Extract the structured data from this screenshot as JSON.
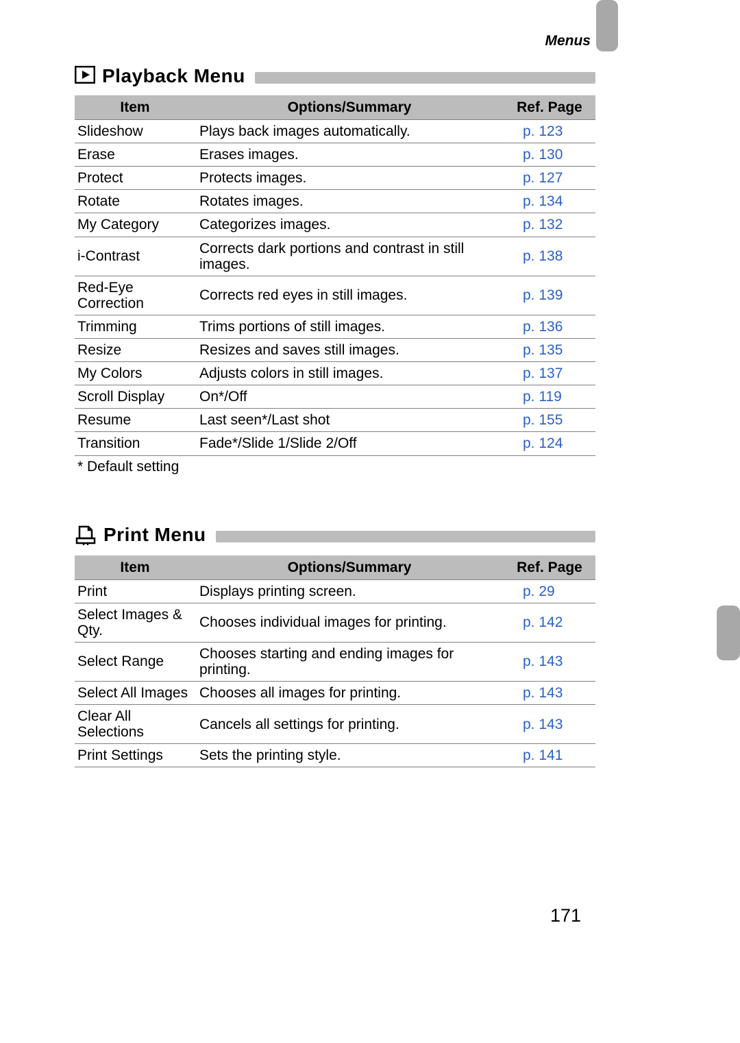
{
  "header": {
    "section_label": "Menus"
  },
  "playback_menu": {
    "title": "Playback Menu",
    "icon": "playback-icon",
    "columns": {
      "item": "Item",
      "options": "Options/Summary",
      "ref": "Ref. Page"
    },
    "rows": [
      {
        "item": "Slideshow",
        "options": "Plays back images automatically.",
        "ref": "p. 123"
      },
      {
        "item": "Erase",
        "options": "Erases images.",
        "ref": "p. 130"
      },
      {
        "item": "Protect",
        "options": "Protects images.",
        "ref": "p. 127"
      },
      {
        "item": "Rotate",
        "options": "Rotates images.",
        "ref": "p. 134"
      },
      {
        "item": "My Category",
        "options": "Categorizes images.",
        "ref": "p. 132"
      },
      {
        "item": "i-Contrast",
        "options": "Corrects dark portions and contrast in still images.",
        "ref": "p. 138"
      },
      {
        "item": "Red-Eye Correction",
        "options": "Corrects red eyes in still images.",
        "ref": "p. 139"
      },
      {
        "item": "Trimming",
        "options": "Trims portions of still images.",
        "ref": "p. 136"
      },
      {
        "item": "Resize",
        "options": "Resizes and saves still images.",
        "ref": "p. 135"
      },
      {
        "item": "My Colors",
        "options": "Adjusts colors in still images.",
        "ref": "p. 137"
      },
      {
        "item": "Scroll Display",
        "options": "On*/Off",
        "ref": "p. 119"
      },
      {
        "item": "Resume",
        "options": "Last seen*/Last shot",
        "ref": "p. 155"
      },
      {
        "item": "Transition",
        "options": "Fade*/Slide 1/Slide 2/Off",
        "ref": "p. 124"
      }
    ],
    "footnote": "* Default setting"
  },
  "print_menu": {
    "title": "Print Menu",
    "icon": "print-icon",
    "columns": {
      "item": "Item",
      "options": "Options/Summary",
      "ref": "Ref. Page"
    },
    "rows": [
      {
        "item": "Print",
        "options": "Displays printing screen.",
        "ref": "p. 29"
      },
      {
        "item": "Select Images & Qty.",
        "options": "Chooses individual images for printing.",
        "ref": "p. 142"
      },
      {
        "item": "Select Range",
        "options": "Chooses starting and ending images for printing.",
        "ref": "p. 143"
      },
      {
        "item": "Select All Images",
        "options": "Chooses all images for printing.",
        "ref": "p. 143"
      },
      {
        "item": "Clear All Selections",
        "options": "Cancels all settings for printing.",
        "ref": "p. 143"
      },
      {
        "item": "Print Settings",
        "options": "Sets the printing style.",
        "ref": "p. 141"
      }
    ]
  },
  "page_number": "171"
}
